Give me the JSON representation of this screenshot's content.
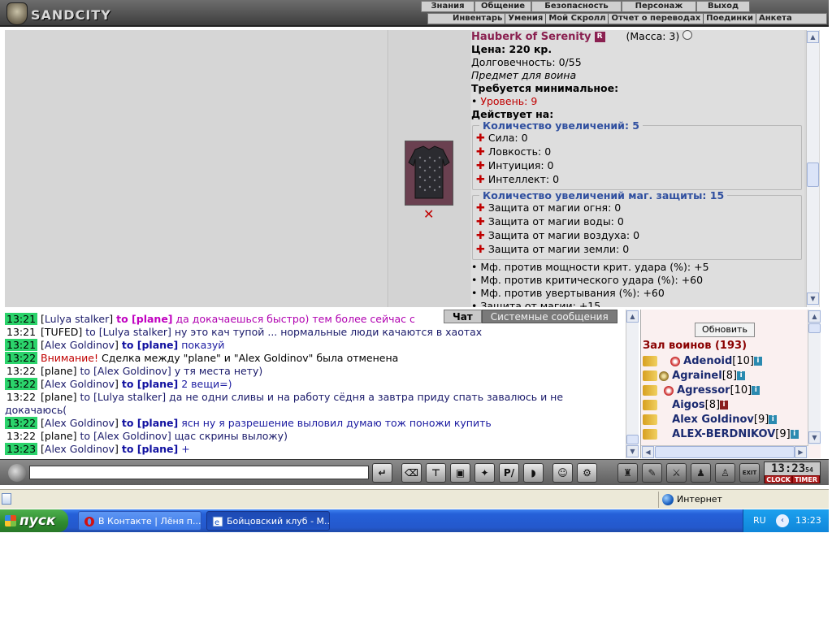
{
  "header": {
    "logo": "SANDCITY",
    "menu_top": [
      "Знания",
      "Общение",
      "Безопасность",
      "Персонаж",
      "Выход"
    ],
    "menu_bottom": [
      "Инвентарь",
      "Умения",
      "Мой Скролл",
      "Отчет о переводах",
      "Поединки",
      "Анкета"
    ]
  },
  "item": {
    "name": "Hauberk of Serenity",
    "badge": "R",
    "mass": "(Масса: 3)",
    "price": "Цена: 220 кр.",
    "durability": "Долговечность: 0/55",
    "class_note": "Предмет для воина",
    "req_title": "Требуется минимальное:",
    "req_level": "Уровень: 9",
    "acts_title": "Действует на:",
    "group1_title": "Количество увеличений: 5",
    "group1": [
      "Сила: 0",
      "Ловкость: 0",
      "Интуиция: 0",
      "Интеллект: 0"
    ],
    "group2_title": "Количество увеличений маг. защиты: 15",
    "group2": [
      "Защита от магии огня: 0",
      "Защита от магии воды: 0",
      "Защита от магии воздуха: 0",
      "Защита от магии земли: 0"
    ],
    "mods": [
      "Мф. против мощности крит. удара (%): +5",
      "Мф. против критического удара (%): +60",
      "Мф. против увертывания (%): +60",
      "Защита от магии: +15"
    ]
  },
  "chat": {
    "tabs": [
      "Чат",
      "Системные сообщения"
    ],
    "lines": [
      {
        "time": "13:21",
        "hl": true,
        "nick": "Lulya stalker",
        "to": "to [plane]",
        "to_style": "to2",
        "text": "да докачаешься быстро) тем более сейчас с",
        "style": "msg-pink"
      },
      {
        "time": "13:21",
        "hl": false,
        "nick": "TUFED",
        "to": "",
        "to_style": "",
        "text": "to [Lulya stalker] ну это кач тупой ... нормальные люди качаются в хаотах",
        "style": "msg-dark"
      },
      {
        "time": "13:21",
        "hl": true,
        "nick": "Alex Goldinov",
        "to": "to [plane]",
        "to_style": "to",
        "text": "показуй",
        "style": "msg-blue"
      },
      {
        "time": "13:22",
        "hl": true,
        "nick": "",
        "to": "",
        "to_style": "",
        "text": "",
        "style": "sys",
        "sys_warn": "Внимание!",
        "sys_text": "Сделка между \"plane\" и \"Alex Goldinov\" была отменена"
      },
      {
        "time": "13:22",
        "hl": false,
        "nick": "plane",
        "to": "",
        "to_style": "",
        "text": "to [Alex Goldinov] у тя места нету)",
        "style": "msg-dark"
      },
      {
        "time": "13:22",
        "hl": true,
        "nick": "Alex Goldinov",
        "to": "to [plane]",
        "to_style": "to",
        "text": "2 вещи=)",
        "style": "msg-blue"
      },
      {
        "time": "13:22",
        "hl": false,
        "nick": "plane",
        "to": "",
        "to_style": "",
        "text": "to [Lulya stalker] да не одни сливы и на работу сёдня а завтра приду спать завалюсь и не докачаюсь(",
        "style": "msg-dark"
      },
      {
        "time": "13:22",
        "hl": true,
        "nick": "Alex Goldinov",
        "to": "to [plane]",
        "to_style": "to",
        "text": "ясн ну я разрешение выловил думаю тож поножи купить",
        "style": "msg-blue"
      },
      {
        "time": "13:22",
        "hl": false,
        "nick": "plane",
        "to": "",
        "to_style": "",
        "text": "to [Alex Goldinov] щас скрины выложу)",
        "style": "msg-dark"
      },
      {
        "time": "13:23",
        "hl": true,
        "nick": "Alex Goldinov",
        "to": "to [plane]",
        "to_style": "to",
        "text": "+",
        "style": "msg-blue"
      }
    ]
  },
  "players": {
    "refresh": "Обновить",
    "hall": "Зал воинов (193)",
    "list": [
      {
        "name": "Adenoid",
        "level": "[10]",
        "info": "i",
        "info_red": false
      },
      {
        "name": "Agrainel",
        "level": "[8]",
        "info": "i",
        "info_red": false
      },
      {
        "name": "Agressor",
        "level": "[10]",
        "info": "i",
        "info_red": false
      },
      {
        "name": "Aigos",
        "level": "[8]",
        "info": "i",
        "info_red": true
      },
      {
        "name": "Alex Goldinov",
        "level": "[9]",
        "info": "i",
        "info_red": false
      },
      {
        "name": "ALEX-BERDNIKOV",
        "level": "[9]",
        "info": "i",
        "info_red": false
      }
    ]
  },
  "clock": {
    "time": "13:23",
    "sec": "54",
    "labels": [
      "CLOCK",
      "TIMER"
    ]
  },
  "toolbar": {
    "exit_label": "EXIT"
  },
  "statusbar": {
    "zone": "Интернет"
  },
  "taskbar": {
    "start": "пуск",
    "tasks": [
      "В Контакте | Лёня п...",
      "Бойцовский клуб - М..."
    ],
    "lang": "RU",
    "time": "13:23"
  }
}
